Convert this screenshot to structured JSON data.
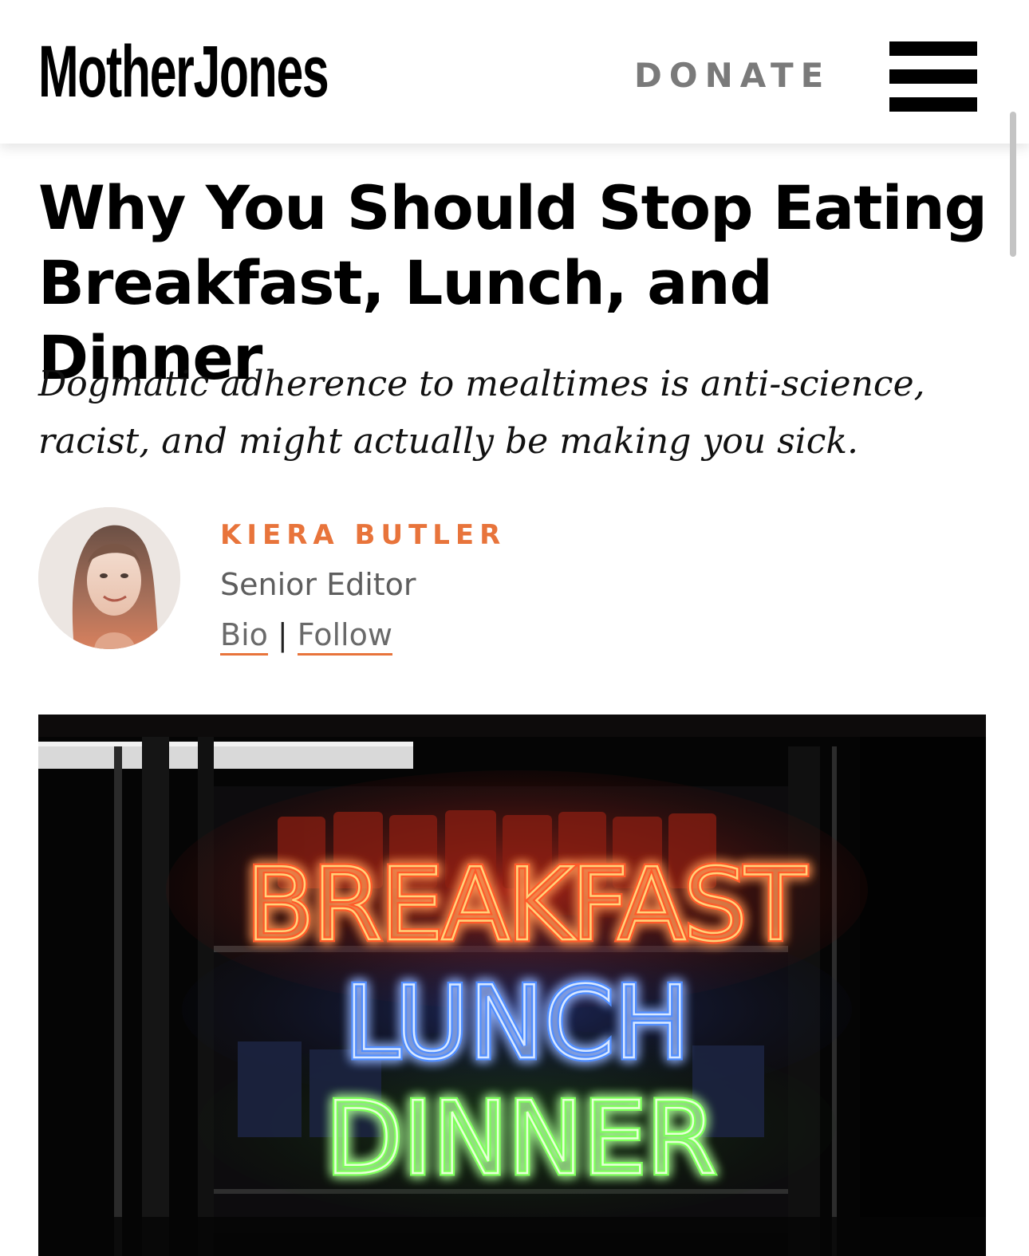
{
  "header": {
    "logo_text": "MotherJones",
    "donate_label": "DONATE",
    "menu_icon": "hamburger-menu-icon"
  },
  "article": {
    "headline": "Why You Should Stop Eating Breakfast, Lunch, and Dinner",
    "dek": "Dogmatic adherence to mealtimes is anti-science, racist, and might actually be making you sick."
  },
  "byline": {
    "author_name": "KIERA BUTLER",
    "author_title": "Senior Editor",
    "bio_link": "Bio",
    "separator": "|",
    "follow_link": "Follow"
  },
  "hero_image": {
    "sign_lines": [
      "BREAKFAST",
      "LUNCH",
      "DINNER"
    ],
    "sign_colors": {
      "breakfast": "#ff5a2a",
      "lunch": "#4f8dff",
      "dinner": "#7bff5a"
    }
  },
  "colors": {
    "accent_orange": "#e8743b",
    "donate_gray": "#7a7a7a",
    "text_black": "#000000"
  }
}
